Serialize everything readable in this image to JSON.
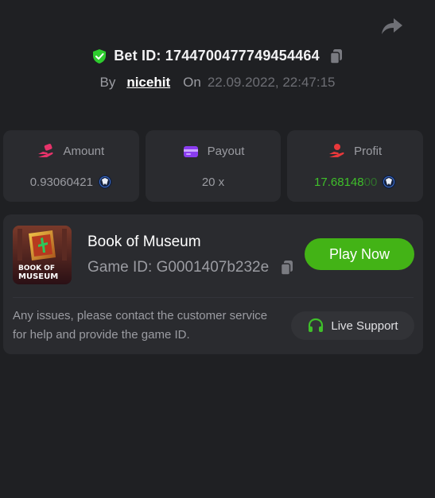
{
  "header": {
    "bet_id": "Bet ID: 1744700477749454464",
    "by_label": "By",
    "username": "nicehit",
    "on_label": "On",
    "date": "22.09.2022, 22:47:15"
  },
  "stats": {
    "amount": {
      "label": "Amount",
      "value": "0.93060421"
    },
    "payout": {
      "label": "Payout",
      "value": "20 x"
    },
    "profit": {
      "label": "Profit",
      "value_main": "17.68148",
      "value_trailing": "00"
    }
  },
  "game": {
    "thumb_line1": "BOOK OF",
    "thumb_line2": "MUSEUM",
    "title": "Book of Museum",
    "game_id": "Game ID: G0001407b232e",
    "play_label": "Play Now",
    "support_note": "Any issues, please contact the customer service for help and provide the game ID.",
    "support_label": "Live Support"
  },
  "colors": {
    "background": "#1f2023",
    "card": "#2a2b2f",
    "accent_green": "#43b316",
    "profit_green": "#3fbf2a",
    "amount_icon": "#e6336a",
    "payout_icon": "#8a3cf0",
    "profit_icon": "#e8383b"
  },
  "icons": {
    "share": "share-arrow-icon",
    "verified": "shield-check-icon",
    "copy": "copy-icon",
    "coin": "coin-icon",
    "support": "headset-icon"
  }
}
